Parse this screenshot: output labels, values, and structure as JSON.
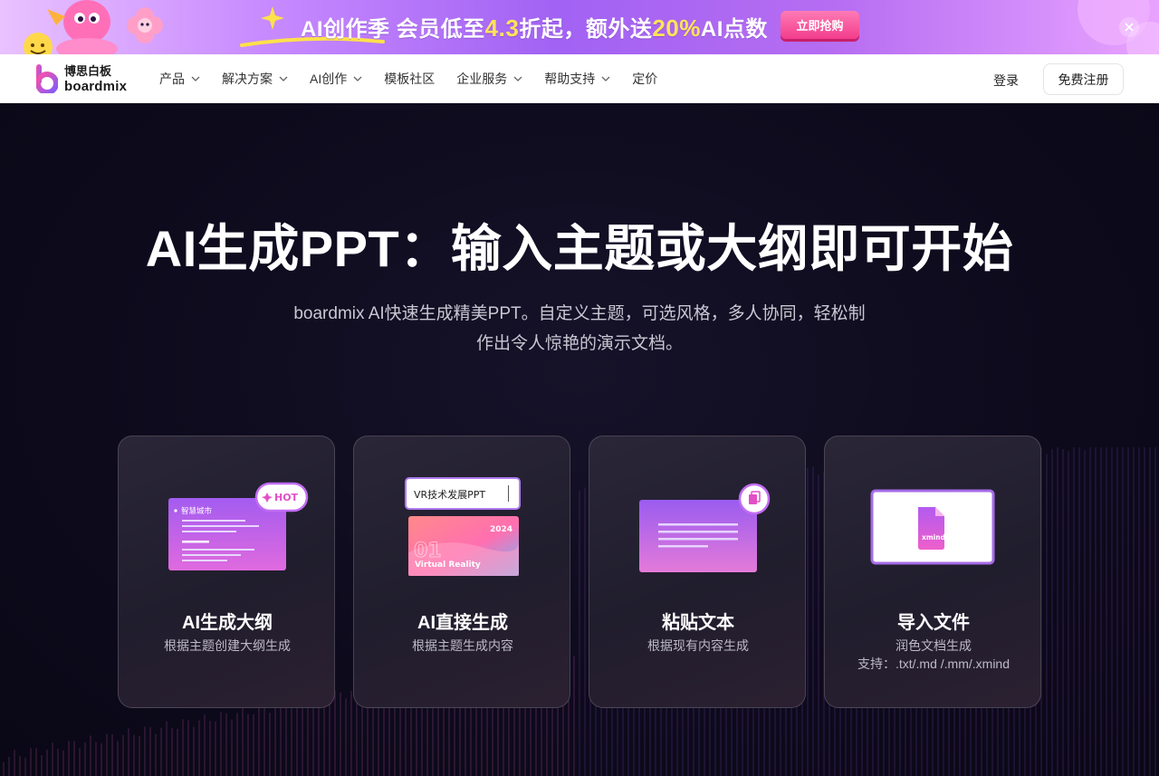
{
  "promo": {
    "text_part1": "AI创作季 会员低至",
    "text_hl1": "4.3",
    "text_part2": "折起，额外送",
    "text_hl2": "20%",
    "text_part3": "AI点数",
    "button_label": "立即抢购",
    "close_icon": "close-icon"
  },
  "nav": {
    "logo_cn": "博思白板",
    "logo_en": "boardmix",
    "items": [
      {
        "label": "产品",
        "has_dropdown": true
      },
      {
        "label": "解决方案",
        "has_dropdown": true
      },
      {
        "label": "AI创作",
        "has_dropdown": true
      },
      {
        "label": "模板社区",
        "has_dropdown": false
      },
      {
        "label": "企业服务",
        "has_dropdown": true
      },
      {
        "label": "帮助支持",
        "has_dropdown": true
      },
      {
        "label": "定价",
        "has_dropdown": false
      }
    ],
    "login_label": "登录",
    "signup_label": "免费注册"
  },
  "hero": {
    "title": "AI生成PPT：输入主题或大纲即可开始",
    "subtitle_line1": "boardmix AI快速生成精美PPT。自定义主题，可选风格，多人协同，轻松制",
    "subtitle_line2": "作出令人惊艳的演示文档。"
  },
  "cards": [
    {
      "title": "AI生成大纲",
      "desc": "根据主题创建大纲生成",
      "art": {
        "slide_heading": "智慧城市",
        "badge": "HOT"
      }
    },
    {
      "title": "AI直接生成",
      "desc": "根据主题生成内容",
      "art": {
        "input_text": "VR技术发展PPT",
        "slide_year": "2024",
        "slide_caption": "Virtual Reality",
        "slide_num": "01"
      }
    },
    {
      "title": "粘贴文本",
      "desc": "根据现有内容生成",
      "art": {
        "icon": "copy-icon"
      }
    },
    {
      "title": "导入文件",
      "desc": "润色文档生成",
      "desc2": "支持：.txt/.md /.mm/.xmind",
      "art": {
        "file_label": "xmind"
      }
    }
  ],
  "colors": {
    "accent_pink": "#f23d8c",
    "accent_purple": "#a262f3",
    "hero_bg": "#0d0a1c"
  }
}
